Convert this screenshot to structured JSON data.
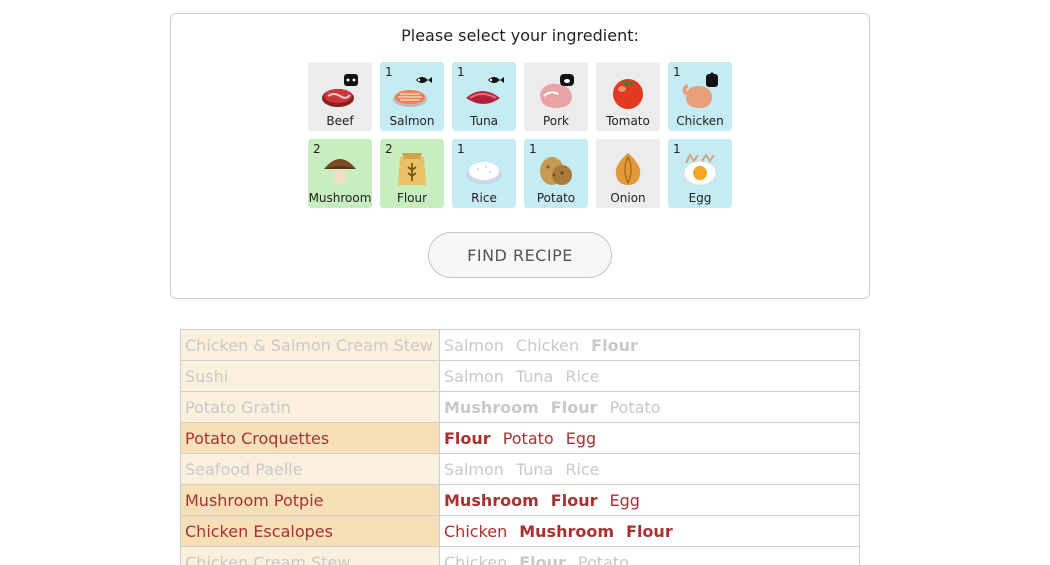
{
  "panel": {
    "prompt": "Please select your ingredient:",
    "find_button": "FIND RECIPE"
  },
  "ingredients": [
    {
      "label": "Beef",
      "count": "",
      "state": "none",
      "icon": "beef-icon"
    },
    {
      "label": "Salmon",
      "count": "1",
      "state": "c1",
      "icon": "salmon-icon"
    },
    {
      "label": "Tuna",
      "count": "1",
      "state": "c1",
      "icon": "tuna-icon"
    },
    {
      "label": "Pork",
      "count": "",
      "state": "none",
      "icon": "pork-icon"
    },
    {
      "label": "Tomato",
      "count": "",
      "state": "none",
      "icon": "tomato-icon"
    },
    {
      "label": "Chicken",
      "count": "1",
      "state": "c1",
      "icon": "chicken-icon"
    },
    {
      "label": "Mushroom",
      "count": "2",
      "state": "c2",
      "icon": "mushroom-icon"
    },
    {
      "label": "Flour",
      "count": "2",
      "state": "c2",
      "icon": "flour-icon"
    },
    {
      "label": "Rice",
      "count": "1",
      "state": "c1",
      "icon": "rice-icon"
    },
    {
      "label": "Potato",
      "count": "1",
      "state": "c1",
      "icon": "potato-icon"
    },
    {
      "label": "Onion",
      "count": "",
      "state": "none",
      "icon": "onion-icon"
    },
    {
      "label": "Egg",
      "count": "1",
      "state": "c1",
      "icon": "egg-icon"
    }
  ],
  "recipes": [
    {
      "name": "Chicken & Salmon Cream Stew",
      "active": false,
      "items": [
        {
          "t": "Salmon",
          "b": false
        },
        {
          "t": "Chicken",
          "b": false
        },
        {
          "t": "Flour",
          "b": true
        }
      ]
    },
    {
      "name": "Sushi",
      "active": false,
      "items": [
        {
          "t": "Salmon",
          "b": false
        },
        {
          "t": "Tuna",
          "b": false
        },
        {
          "t": "Rice",
          "b": false
        }
      ]
    },
    {
      "name": "Potato Gratin",
      "active": false,
      "items": [
        {
          "t": "Mushroom",
          "b": true
        },
        {
          "t": "Flour",
          "b": true
        },
        {
          "t": "Potato",
          "b": false
        }
      ]
    },
    {
      "name": "Potato Croquettes",
      "active": true,
      "items": [
        {
          "t": "Flour",
          "b": true
        },
        {
          "t": "Potato",
          "b": false
        },
        {
          "t": "Egg",
          "b": false
        }
      ]
    },
    {
      "name": "Seafood Paelle",
      "active": false,
      "items": [
        {
          "t": "Salmon",
          "b": false
        },
        {
          "t": "Tuna",
          "b": false
        },
        {
          "t": "Rice",
          "b": false
        }
      ]
    },
    {
      "name": "Mushroom Potpie",
      "active": true,
      "items": [
        {
          "t": "Mushroom",
          "b": true
        },
        {
          "t": "Flour",
          "b": true
        },
        {
          "t": "Egg",
          "b": false
        }
      ]
    },
    {
      "name": "Chicken Escalopes",
      "active": true,
      "items": [
        {
          "t": "Chicken",
          "b": false
        },
        {
          "t": "Mushroom",
          "b": true
        },
        {
          "t": "Flour",
          "b": true
        }
      ]
    },
    {
      "name": "Chicken Cream Stew",
      "active": false,
      "items": [
        {
          "t": "Chicken",
          "b": false
        },
        {
          "t": "Flour",
          "b": true
        },
        {
          "t": "Potato",
          "b": false
        }
      ]
    }
  ]
}
